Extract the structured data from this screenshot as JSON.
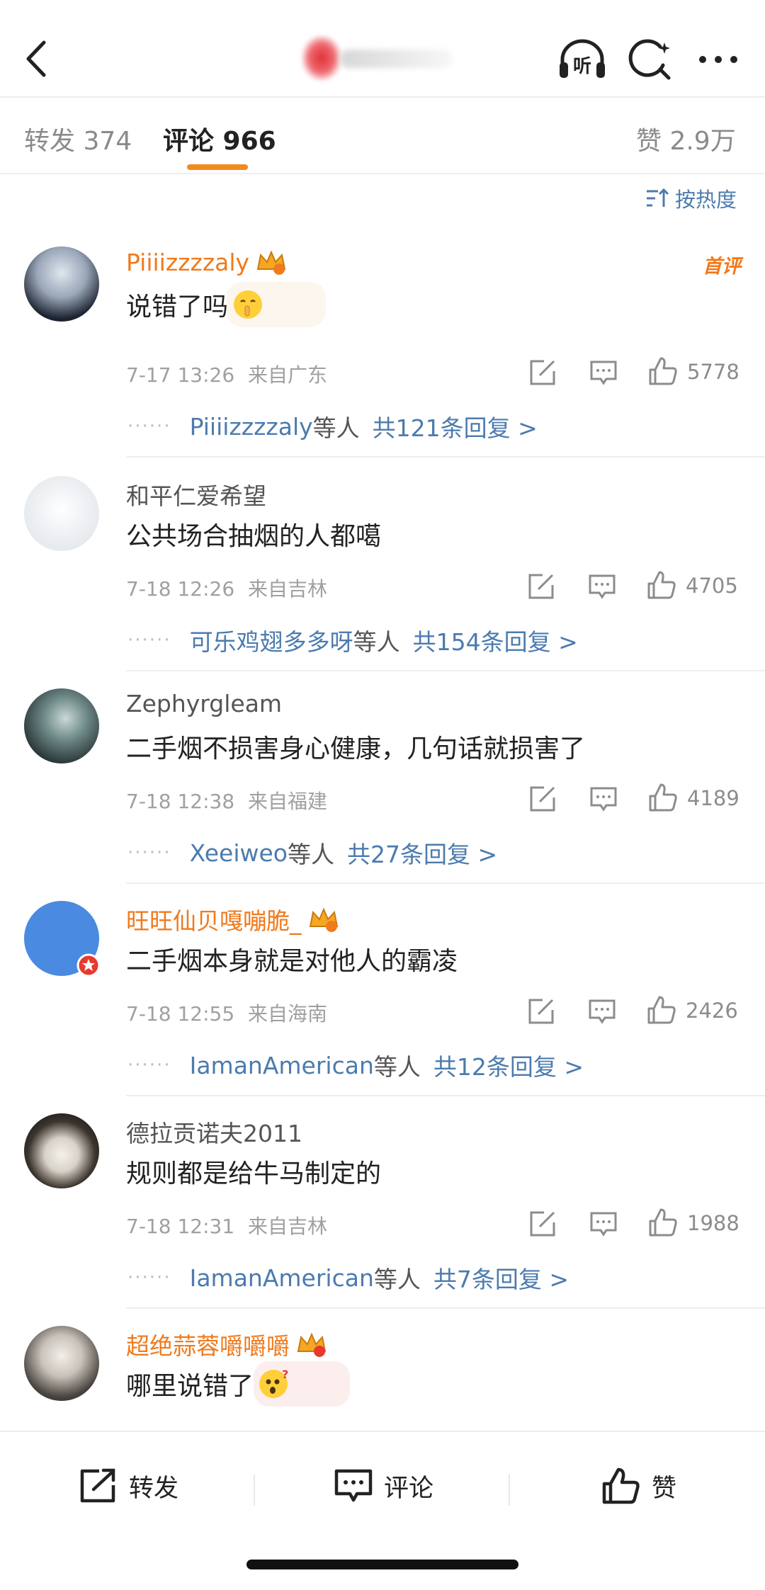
{
  "nav": {
    "listen_label": "听"
  },
  "tabs": [
    {
      "label": "转发 374"
    },
    {
      "label": "评论 966"
    },
    {
      "label": "赞 2.9万"
    }
  ],
  "sort_label": "按热度",
  "comments": [
    {
      "user": "Piiiizzzzaly",
      "text": "说错了吗",
      "time": "7-17 13:26",
      "location": "来自广东",
      "likes": "5778",
      "reply_who": "Piiiizzzzaly",
      "reply_etc": "等人",
      "reply_count": "共121条回复 >",
      "badge": "首评"
    },
    {
      "user": "和平仁爱希望",
      "text": "公共场合抽烟的人都噶",
      "time": "7-18 12:26",
      "location": "来自吉林",
      "likes": "4705",
      "reply_who": "可乐鸡翅多多呀",
      "reply_etc": "等人",
      "reply_count": "共154条回复 >"
    },
    {
      "user": "Zephyrgleam",
      "text": "二手烟不损害身心健康，几句话就损害了",
      "time": "7-18 12:38",
      "location": "来自福建",
      "likes": "4189",
      "reply_who": "Xeeiweo",
      "reply_etc": "等人",
      "reply_count": "共27条回复 >"
    },
    {
      "user": "旺旺仙贝嘎嘣脆_",
      "text": "二手烟本身就是对他人的霸凌",
      "time": "7-18 12:55",
      "location": "来自海南",
      "likes": "2426",
      "reply_who": "IamanAmerican",
      "reply_etc": "等人",
      "reply_count": "共12条回复 >"
    },
    {
      "user": "德拉贡诺夫2011",
      "text": "规则都是给牛马制定的",
      "time": "7-18 12:31",
      "location": "来自吉林",
      "likes": "1988",
      "reply_who": "IamanAmerican",
      "reply_etc": "等人",
      "reply_count": "共7条回复 >"
    },
    {
      "user": "超绝蒜蓉嚼嚼嚼",
      "text": "哪里说错了"
    }
  ],
  "bottom": {
    "repost_label": "转发",
    "comment_label": "评论",
    "like_label": "赞"
  },
  "colors": {
    "accent": "#f28a1e",
    "vip_name": "#f07a1c",
    "link_blue": "#4c7bae"
  }
}
